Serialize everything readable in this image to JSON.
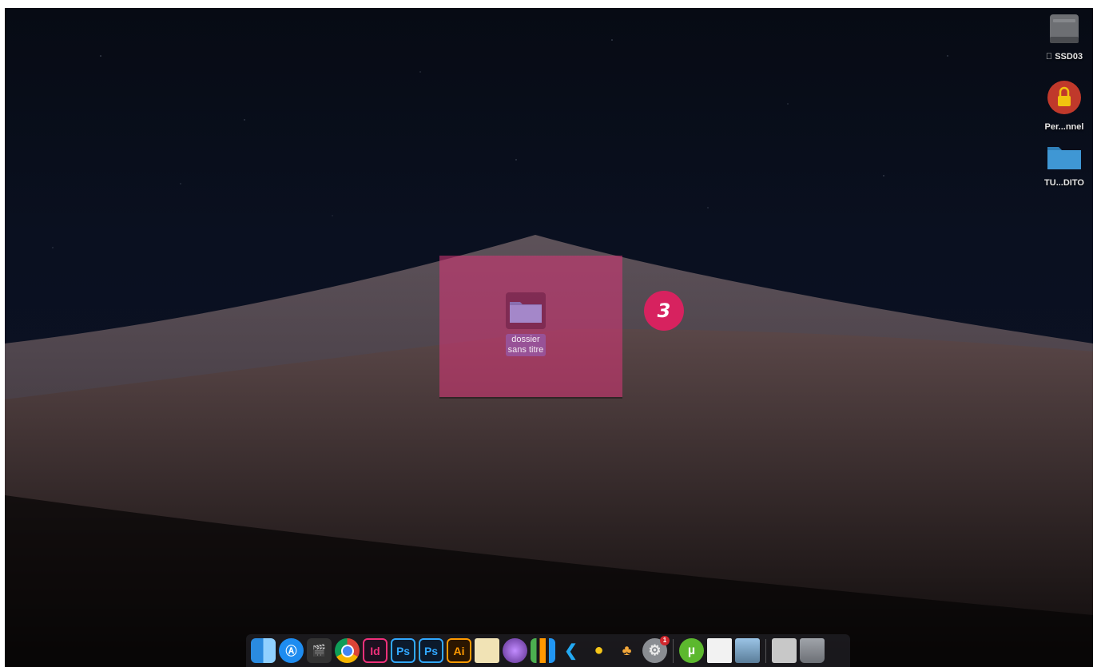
{
  "desktop": {
    "icons": [
      {
        "label": " SSD03",
        "apple_prefix": "",
        "icon": "hard-drive-icon"
      },
      {
        "label": "Per...nnel",
        "icon": "lock-icon"
      },
      {
        "label": "TU...DITO",
        "icon": "folder-icon"
      }
    ],
    "new_folder": {
      "line1": "dossier",
      "line2": "sans titre",
      "icon": "folder-icon"
    },
    "step_badge": "3",
    "highlight_color": "#db3778"
  },
  "dock": {
    "items": [
      {
        "name": "finder",
        "icon": "finder-icon"
      },
      {
        "name": "app-store",
        "icon": "app-store-icon"
      },
      {
        "name": "final-cut",
        "icon": "clapperboard-icon"
      },
      {
        "name": "chrome",
        "icon": "chrome-icon"
      },
      {
        "name": "indesign",
        "icon": "indesign-icon",
        "text": "Id",
        "color": "#f0307a"
      },
      {
        "name": "photoshop-1",
        "icon": "photoshop-icon",
        "text": "Ps",
        "color": "#31a8ff"
      },
      {
        "name": "photoshop-2",
        "icon": "photoshop-icon",
        "text": "Ps",
        "color": "#31a8ff"
      },
      {
        "name": "illustrator",
        "icon": "illustrator-icon",
        "text": "Ai",
        "color": "#ff9a00"
      },
      {
        "name": "textedit",
        "icon": "notepad-icon"
      },
      {
        "name": "motion",
        "icon": "motion-icon"
      },
      {
        "name": "numbers",
        "icon": "bar-chart-icon"
      },
      {
        "name": "vscode",
        "icon": "vscode-icon"
      },
      {
        "name": "cyberduck",
        "icon": "duck-icon"
      },
      {
        "name": "pineapple",
        "icon": "cocktail-icon"
      },
      {
        "name": "system-preferences",
        "icon": "gear-icon",
        "badge": "1"
      },
      {
        "name": "utorrent",
        "icon": "utorrent-icon"
      },
      {
        "name": "document",
        "icon": "document-icon"
      },
      {
        "name": "preview",
        "icon": "photo-icon"
      },
      {
        "name": "stack",
        "icon": "stack-icon"
      },
      {
        "name": "trash",
        "icon": "trash-icon"
      }
    ]
  }
}
